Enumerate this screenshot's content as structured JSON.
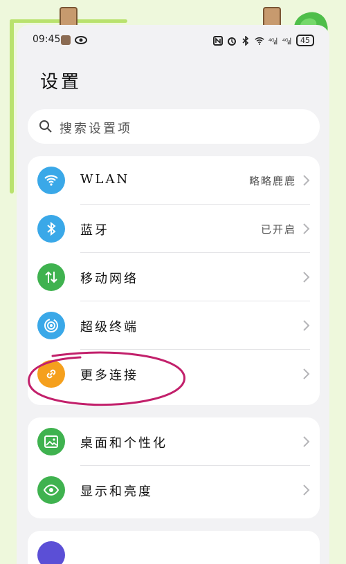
{
  "status_bar": {
    "time": "09:45",
    "battery": "45",
    "indicators": [
      "nfc-icon",
      "alarm-icon",
      "bluetooth-icon",
      "wifi-icon",
      "signal-4g-icon",
      "signal-4g-icon"
    ]
  },
  "header": {
    "title": "设置"
  },
  "search": {
    "placeholder": "搜索设置项"
  },
  "groups": [
    {
      "items": [
        {
          "label": "WLAN",
          "value": "略略鹿鹿",
          "icon": "wifi-icon",
          "color": "#3aa8e8"
        },
        {
          "label": "蓝牙",
          "value": "已开启",
          "icon": "bluetooth-icon",
          "color": "#3aa8e8"
        },
        {
          "label": "移动网络",
          "value": "",
          "icon": "mobile-data-icon",
          "color": "#3fb24f"
        },
        {
          "label": "超级终端",
          "value": "",
          "icon": "super-device-icon",
          "color": "#3aa8e8"
        },
        {
          "label": "更多连接",
          "value": "",
          "icon": "link-icon",
          "color": "#f5a01d"
        }
      ]
    },
    {
      "items": [
        {
          "label": "桌面和个性化",
          "value": "",
          "icon": "image-icon",
          "color": "#3fb24f"
        },
        {
          "label": "显示和亮度",
          "value": "",
          "icon": "eye-icon",
          "color": "#3fb24f"
        }
      ]
    }
  ],
  "colors": {
    "annotation": "#c2206b",
    "background": "#eef8dc"
  }
}
